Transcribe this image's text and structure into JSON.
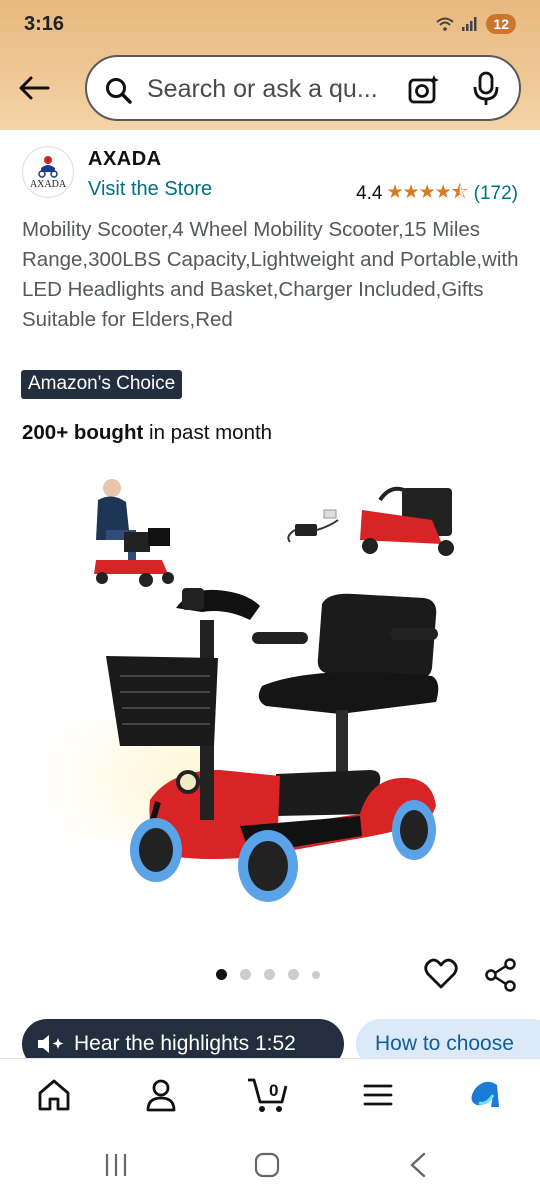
{
  "status_bar": {
    "time": "3:16",
    "battery": "12"
  },
  "search": {
    "placeholder": "Search or ask a qu..."
  },
  "brand": {
    "name": "AXADA",
    "logo_text": "AXADA",
    "visit_store": "Visit the Store"
  },
  "rating": {
    "value": "4.4",
    "stars": "★★★★⯪",
    "count": "(172)"
  },
  "product": {
    "title": "Mobility Scooter,4 Wheel Mobility Scooter,15 Miles Range,300LBS Capacity,Lightweight and Portable,with LED Headlights and Basket,Charger Included,Gifts Suitable for Elders,Red",
    "badge": "Amazon's Choice",
    "bought_bold": "200+ bought",
    "bought_rest": " in past month",
    "image_count": 5,
    "active_image": 1
  },
  "chips": {
    "highlights": "Hear the highlights 1:52",
    "how_to_choose": "How to choose"
  },
  "bottom_nav": [
    "home-icon",
    "account-icon",
    "cart-icon",
    "menu-icon",
    "rufus-icon"
  ],
  "cart_count": "0",
  "colors": {
    "accent": "#007185",
    "star": "#de7921",
    "badge_bg": "#232f3e",
    "scooter_red": "#d82424"
  }
}
